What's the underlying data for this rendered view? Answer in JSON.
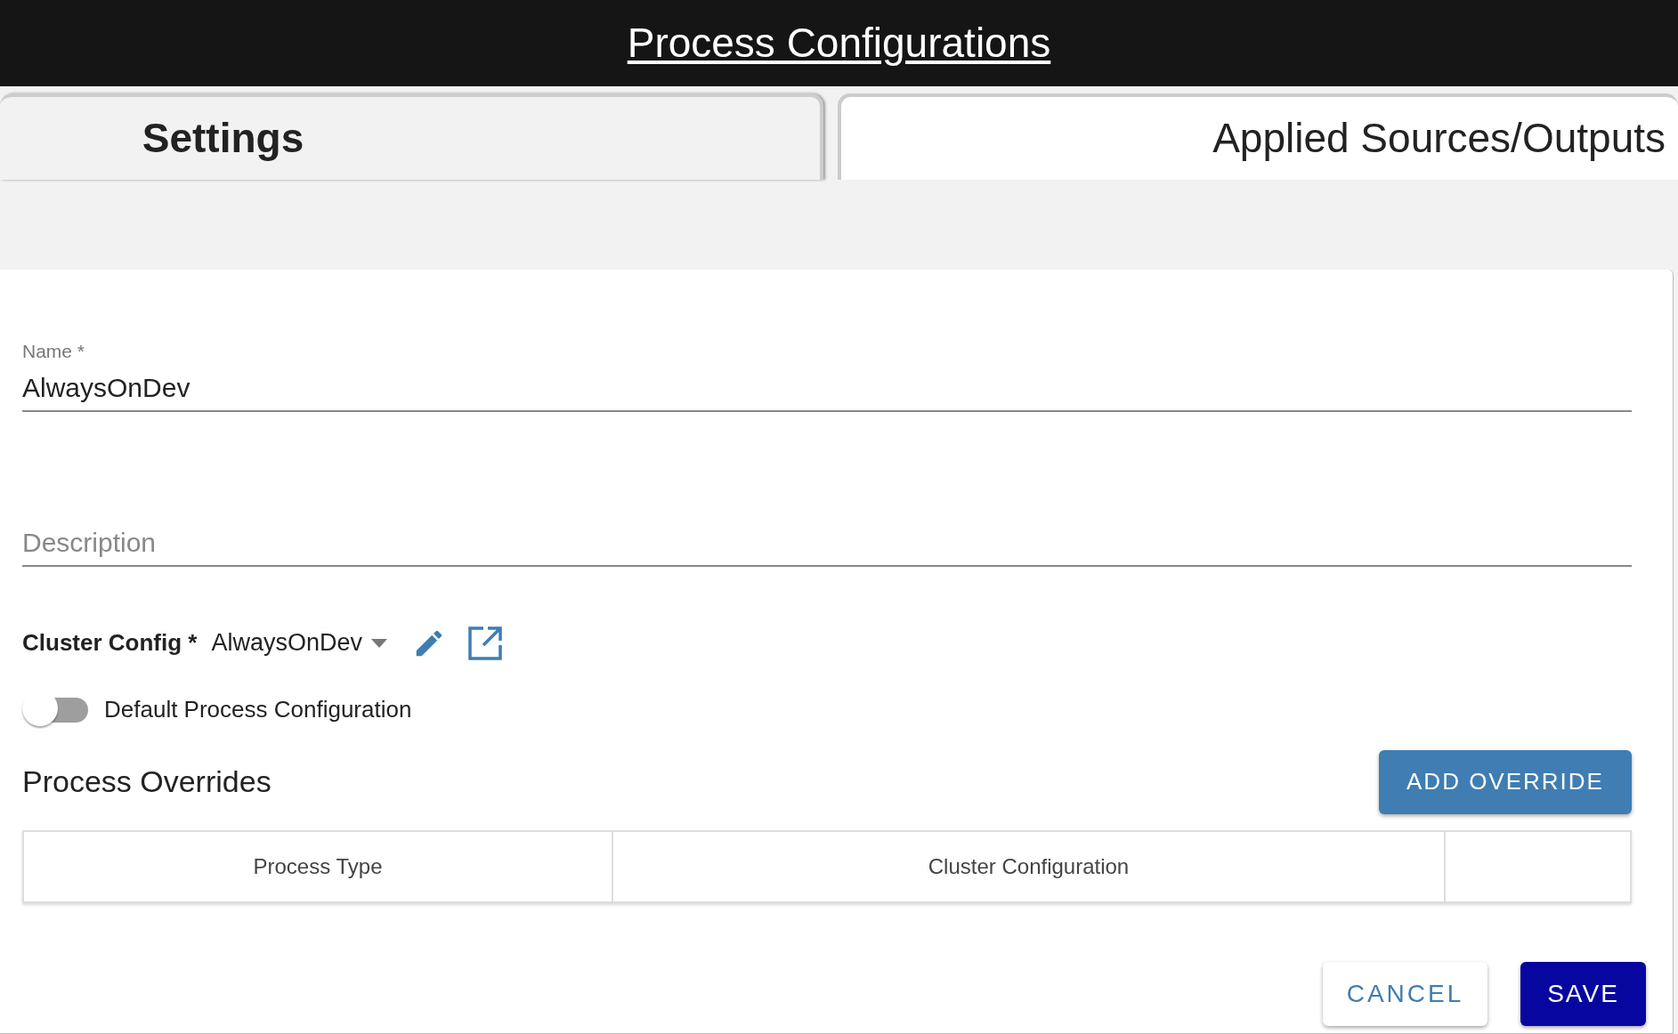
{
  "header": {
    "title": "Process Configurations"
  },
  "tabs": [
    {
      "label": "Settings",
      "selected": true
    },
    {
      "label": "Applied Sources/Outputs",
      "selected": false
    }
  ],
  "form": {
    "name": {
      "label": "Name *",
      "value": "AlwaysOnDev"
    },
    "description": {
      "placeholder": "Description"
    },
    "cluster_config": {
      "label": "Cluster Config *",
      "value": "AlwaysOnDev"
    },
    "default_toggle": {
      "label": "Default Process Configuration",
      "on": false
    }
  },
  "overrides": {
    "title": "Process Overrides",
    "add_button": "ADD OVERRIDE",
    "columns": [
      "Process Type",
      "Cluster Configuration",
      ""
    ]
  },
  "buttons": {
    "cancel": "CANCEL",
    "save": "SAVE"
  }
}
